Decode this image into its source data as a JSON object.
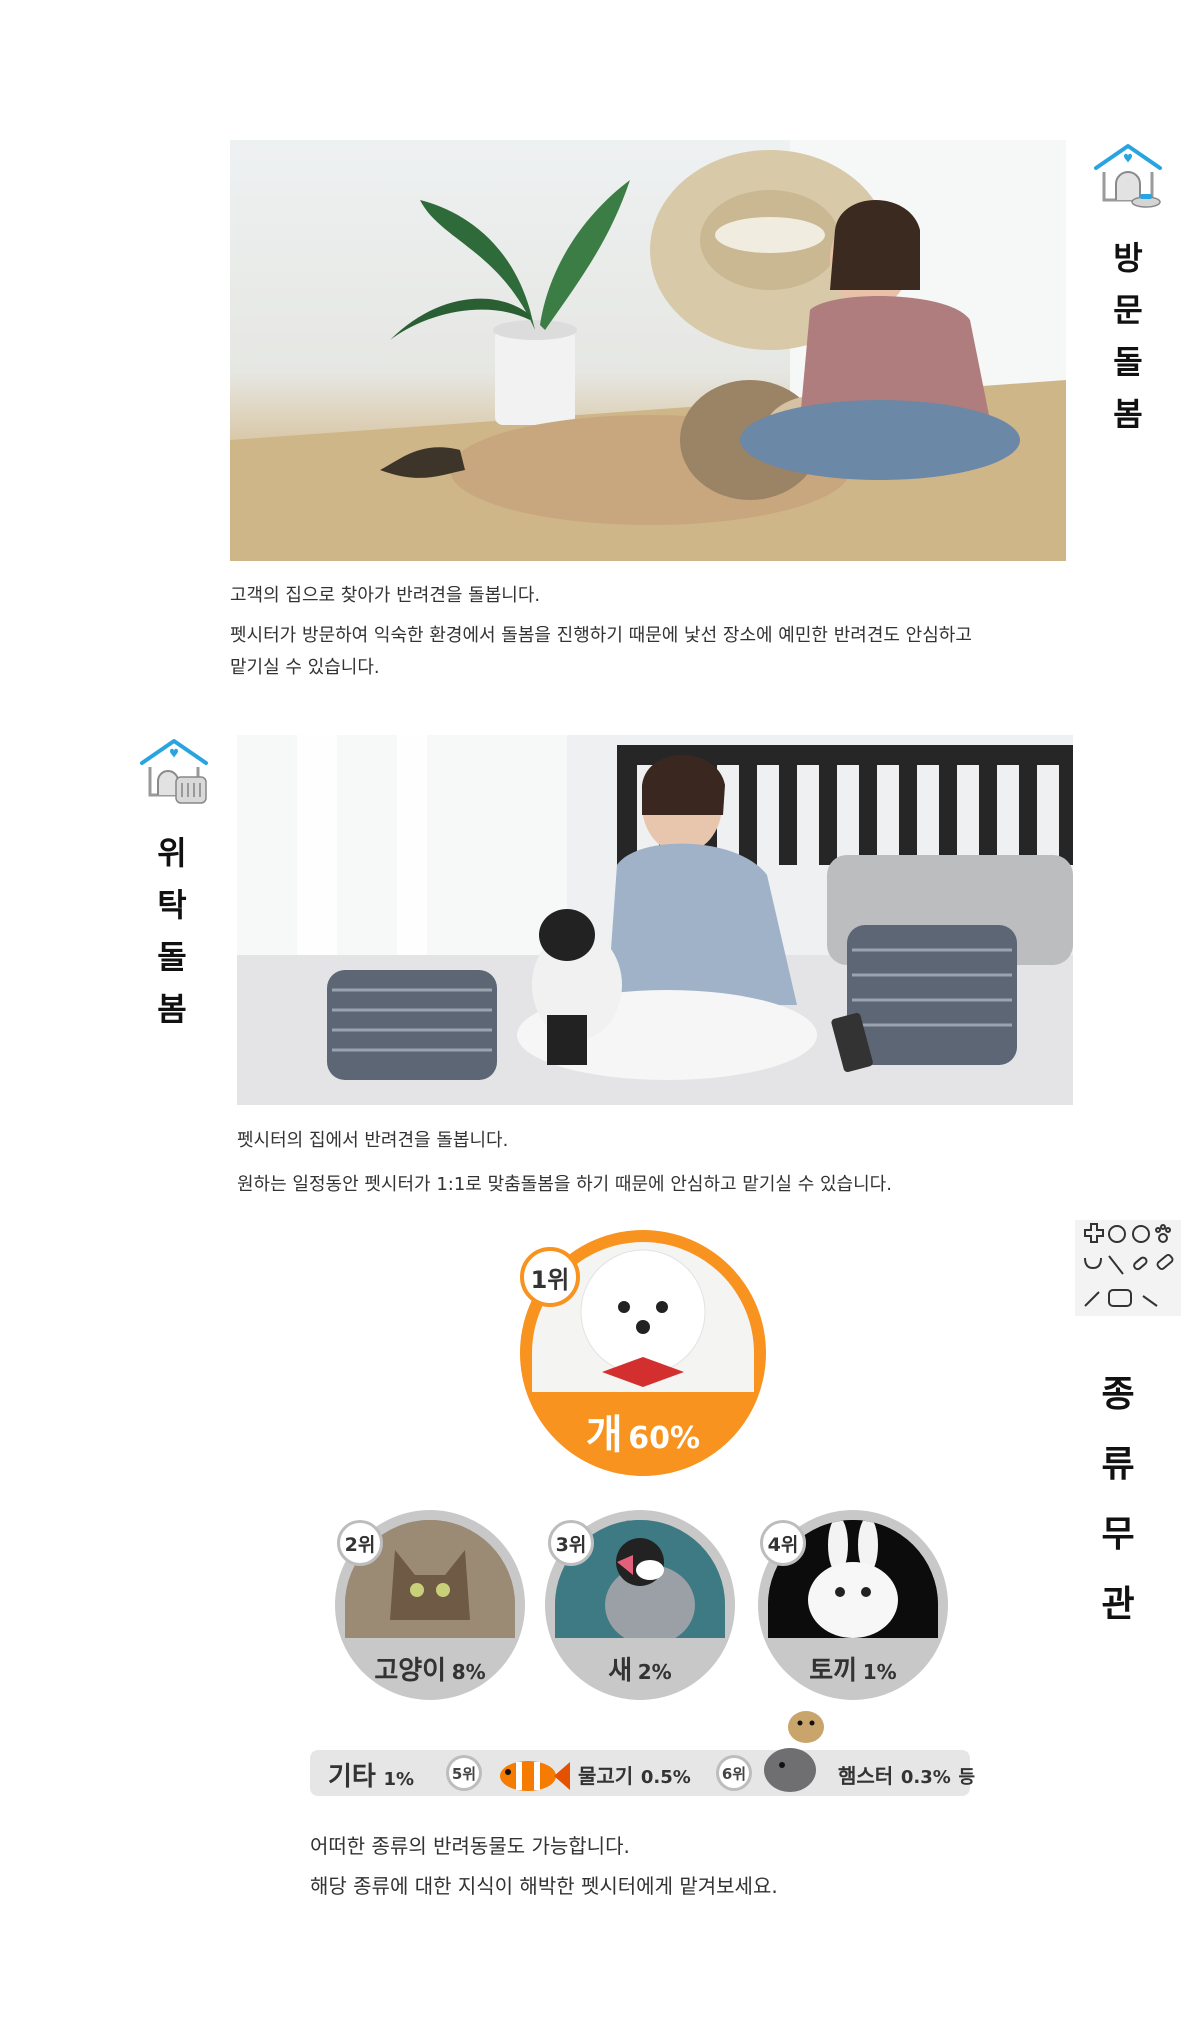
{
  "sections": {
    "visit": {
      "title_chars": [
        "방",
        "문",
        "돌",
        "봄"
      ],
      "line1": "고객의 집으로 찾아가 반려견을 돌봅니다.",
      "line2": "펫시터가 방문하여 익숙한 환경에서 돌봄을 진행하기 때문에 낯선 장소에 예민한 반려견도 안심하고",
      "line3": "맡기실 수 있습니다."
    },
    "boarding": {
      "title_chars": [
        "위",
        "탁",
        "돌",
        "봄"
      ],
      "line1": "펫시터의 집에서 반려견을 돌봅니다.",
      "line2": "원하는 일정동안 펫시터가 1:1로 맞춤돌봄을 하기 때문에 안심하고 맡기실 수 있습니다."
    },
    "species": {
      "title_chars": [
        "종",
        "류",
        "무",
        "관"
      ],
      "line1": "어떠한 종류의 반려동물도 가능합니다.",
      "line2": "해당 종류에 대한 지식이 해박한 펫시터에게 맡겨보세요."
    }
  },
  "ranking": {
    "first": {
      "rank": "1위",
      "name": "개",
      "pct": "60%"
    },
    "second": {
      "rank": "2위",
      "name": "고양이",
      "pct": "8%"
    },
    "third": {
      "rank": "3위",
      "name": "새",
      "pct": "2%"
    },
    "fourth": {
      "rank": "4위",
      "name": "토끼",
      "pct": "1%"
    },
    "other": {
      "name": "기타",
      "pct": "1%"
    },
    "fifth": {
      "rank": "5위",
      "name": "물고기",
      "pct": "0.5%"
    },
    "sixth": {
      "rank": "6위",
      "name": "햄스터",
      "pct": "0.3%",
      "suffix": "등"
    }
  },
  "colors": {
    "accent_orange": "#f7931e",
    "icon_blue": "#2aa4e0",
    "circle_grey": "#c8c8c8"
  }
}
